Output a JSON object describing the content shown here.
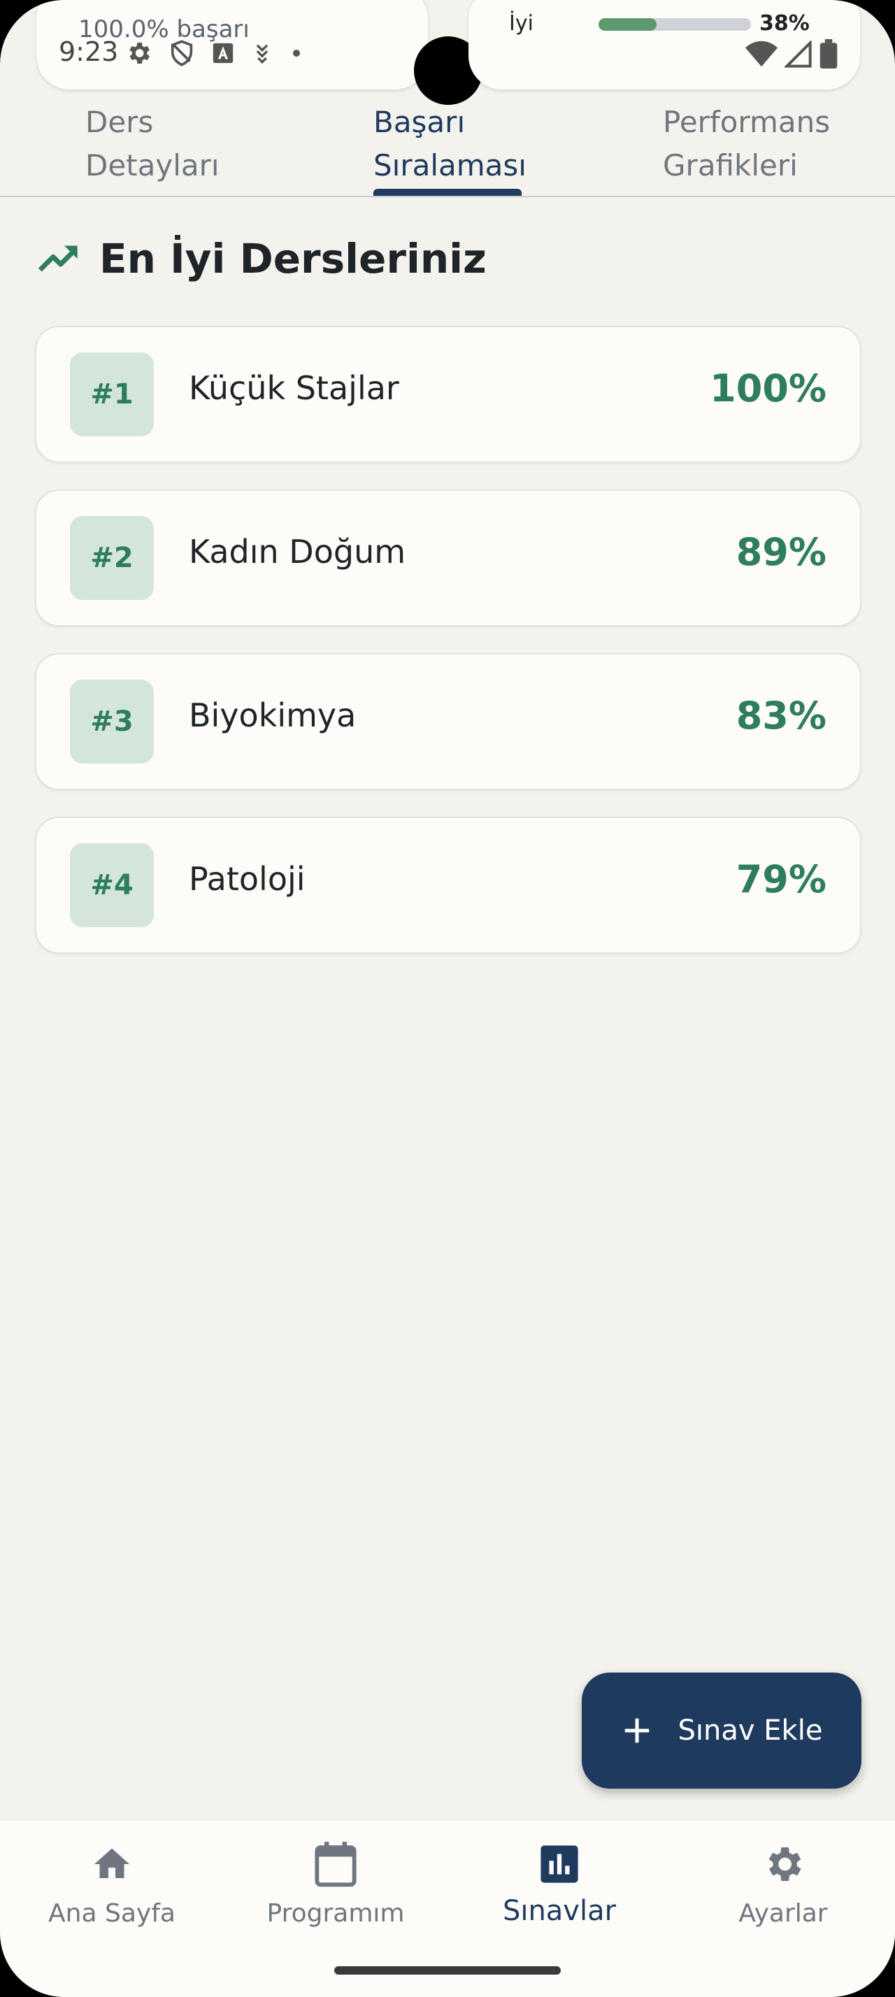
{
  "status_bar": {
    "success_text": "100.0% başarı",
    "time": "9:23",
    "quality_label": "İyi",
    "progress_fraction": 0.38,
    "battery_percent": "38%"
  },
  "tabs": [
    {
      "label_line1": "Ders",
      "label_line2": "Detayları"
    },
    {
      "label_line1": "Başarı",
      "label_line2": "Sıralaması"
    },
    {
      "label_line1": "Performans",
      "label_line2": "Grafikleri"
    }
  ],
  "active_tab_index": 1,
  "section": {
    "title": "En İyi Dersleriniz",
    "icon": "trending-up-icon"
  },
  "rankings": [
    {
      "rank": "#1",
      "course": "Küçük Stajlar",
      "score": "100%"
    },
    {
      "rank": "#2",
      "course": "Kadın Doğum",
      "score": "89%"
    },
    {
      "rank": "#3",
      "course": "Biyokimya",
      "score": "83%"
    },
    {
      "rank": "#4",
      "course": "Patoloji",
      "score": "79%"
    }
  ],
  "fab": {
    "label": "Sınav Ekle",
    "icon": "plus-icon"
  },
  "bottom_nav": [
    {
      "label": "Ana Sayfa",
      "icon": "home-icon"
    },
    {
      "label": "Programım",
      "icon": "calendar-icon"
    },
    {
      "label": "Sınavlar",
      "icon": "bar-chart-icon"
    },
    {
      "label": "Ayarlar",
      "icon": "gear-icon"
    }
  ],
  "active_nav_index": 2,
  "colors": {
    "accent": "#1f3a5f",
    "success": "#2e7d5b",
    "background": "#f4f2ed",
    "card": "#fdfcf8"
  }
}
